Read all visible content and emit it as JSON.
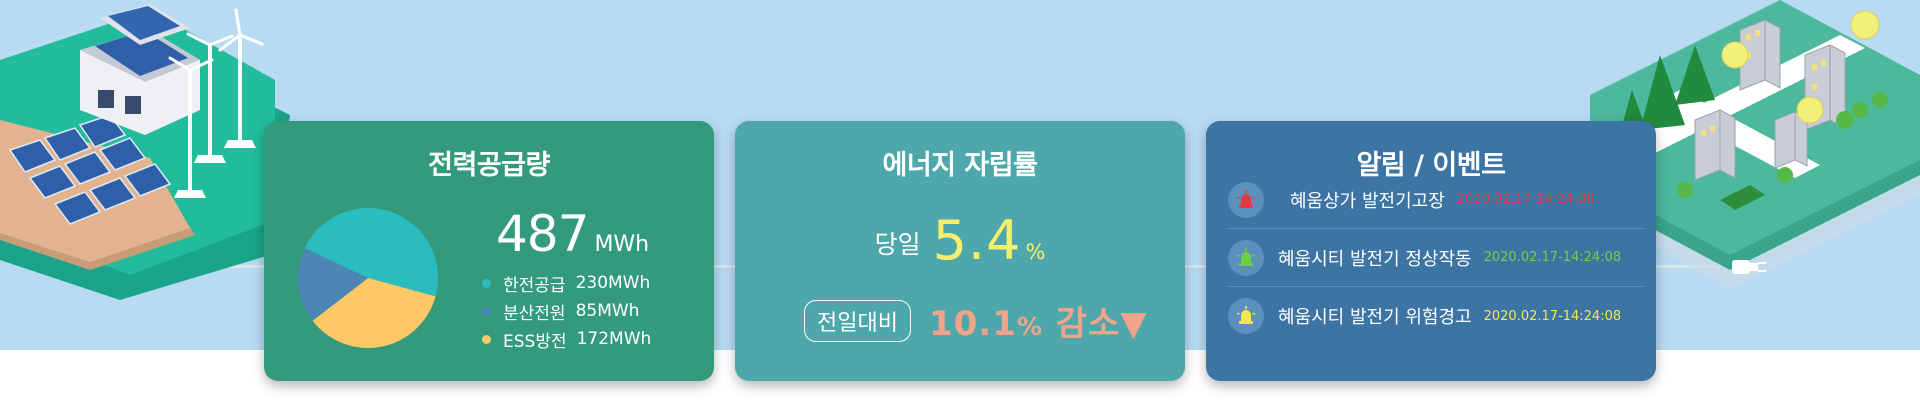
{
  "colors": {
    "sky": "#b8daf3",
    "supply_card": "#339b7c",
    "self_card": "#4ea8ab",
    "alarm_card": "#3c74a4",
    "highlight_yellow": "#f6ef6e",
    "decrease": "#f0a48a",
    "alarm_red": "#e23c3c",
    "alarm_green": "#6cd142",
    "alarm_yellow": "#f4e64c"
  },
  "supply": {
    "title": "전력공급량",
    "total": "487",
    "unit": "MWh",
    "items": [
      {
        "label": "한전공급",
        "value": "230MWh",
        "color": "#2bbcc0"
      },
      {
        "label": "분산전원",
        "value": "85MWh",
        "color": "#4b86b5"
      },
      {
        "label": "ESS방전",
        "value": "172MWh",
        "color": "#fec866"
      }
    ]
  },
  "self_sufficiency": {
    "title": "에너지 자립률",
    "today_label": "당일",
    "today_value": "5.4",
    "today_unit": "%",
    "compare_label": "전일대비",
    "compare_value": "10.1",
    "compare_unit": "%",
    "compare_dir": "감소▼"
  },
  "alarms": {
    "title": "알림 / 이벤트",
    "items": [
      {
        "text": "혜움상가 발전기고장",
        "time": "2020.02.17-14:24:08",
        "status": "error",
        "icon": "alarm-bell-icon"
      },
      {
        "text": "혜움시티 발전기 정상작동",
        "time": "2020.02.17-14:24:08",
        "status": "normal",
        "icon": "alarm-bell-icon"
      },
      {
        "text": "혜움시티 발전기 위험경고",
        "time": "2020.02.17-14:24:08",
        "status": "warning",
        "icon": "alarm-bell-icon"
      }
    ]
  },
  "chart_data": {
    "type": "pie",
    "title": "",
    "categories": [
      "한전공급",
      "분산전원",
      "ESS방전"
    ],
    "values": [
      230,
      85,
      172
    ],
    "unit": "MWh",
    "colors": [
      "#2bbcc0",
      "#4b86b5",
      "#fec866"
    ]
  },
  "decor": {
    "left_scene": "solar-wind-illustration",
    "right_scene": "smart-city-illustration",
    "plug": "power-plug-icon"
  }
}
